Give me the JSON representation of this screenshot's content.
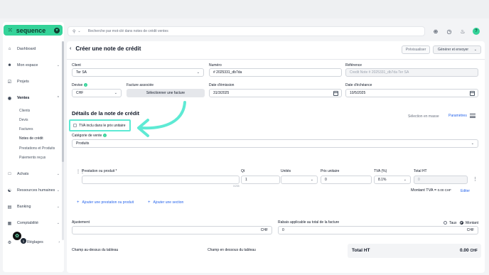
{
  "app": {
    "name": "sequence",
    "logo_mark": "⁙"
  },
  "search": {
    "placeholder": "Recherche par mot-clé dans notes de crédit ventes"
  },
  "sidebar": {
    "items": [
      {
        "label": "Dashboard",
        "icon": "home-icon"
      },
      {
        "label": "Mon espace",
        "icon": "user-icon"
      },
      {
        "label": "Projets",
        "icon": "check-icon"
      },
      {
        "label": "Ventes",
        "icon": "money-bag-icon"
      },
      {
        "label": "Achats",
        "icon": "clipboard-icon"
      },
      {
        "label": "Ressources humaines",
        "icon": "people-icon"
      },
      {
        "label": "Banking",
        "icon": "bank-icon"
      },
      {
        "label": "Comptabilité",
        "icon": "ledger-icon"
      },
      {
        "label": "Réglages",
        "icon": "gear-icon"
      }
    ],
    "ventes_sub": [
      "Clients",
      "Devis",
      "Factures",
      "Notes de crédit",
      "Prestations et Produits",
      "Paiements reçus"
    ],
    "avatar_badge": "1"
  },
  "header": {
    "title": "Créer une note de crédit",
    "preview_label": "Prévisualiser",
    "generate_label": "Générer et envoyer"
  },
  "form": {
    "client_label": "Client",
    "client_value": "Ter SA",
    "numero_label": "Numéro",
    "numero_value": "# 2025331_db7da",
    "reference_label": "Référence",
    "reference_placeholder": "Credit Note # 2025331_db7da Ter SA",
    "devise_label": "Devise",
    "devise_value": "CHF",
    "facture_label": "Facture associée",
    "facture_button": "Sélectionner une facture",
    "emission_label": "Date d'émission",
    "emission_value": "31/3/2025",
    "echeance_label": "Date d'échéance",
    "echeance_value": "10/5/2025"
  },
  "details": {
    "title": "Détails de la note de crédit",
    "selection_masse": "Sélection en masse",
    "parametres": "Paramètres",
    "tva_label": "TVA inclu dans le prix unitaire",
    "categorie_label": "Catégorie de vente",
    "categorie_value": "Produits"
  },
  "table": {
    "headers": {
      "prestation": "Prestation ou produit *",
      "qt": "Qt",
      "unites": "Unités",
      "prix": "Prix unitaire",
      "tva": "TVA (%)",
      "total": "Total HT"
    },
    "row": {
      "qt": "1",
      "prix": "0",
      "tva": "8.1%",
      "total": "0",
      "counter": "0/255"
    },
    "montant_tva_label": "Montant TVA =",
    "montant_tva_value": "0.00 CHF",
    "edit_label": "Editer",
    "add_prestation": "Ajouter une prestation ou produit",
    "add_section": "Ajouter une section"
  },
  "footer": {
    "ajustement_label": "Ajustement",
    "ajustement_currency": "CHF",
    "rabais_label": "Rabais applicable au total de la facture",
    "rabais_value": "0",
    "rabais_currency": "CHF",
    "taux_label": "Taux",
    "montant_label": "Montant",
    "champ_dessus": "Champ au-dessus du tableau",
    "champ_dessous": "Champ en dessous du tableau",
    "total_ht_label": "Total HT",
    "total_ht_value": "0.00",
    "total_ht_currency": "CHF"
  },
  "colors": {
    "accent": "#34d399",
    "highlight": "#5eead4",
    "link": "#2563eb"
  }
}
